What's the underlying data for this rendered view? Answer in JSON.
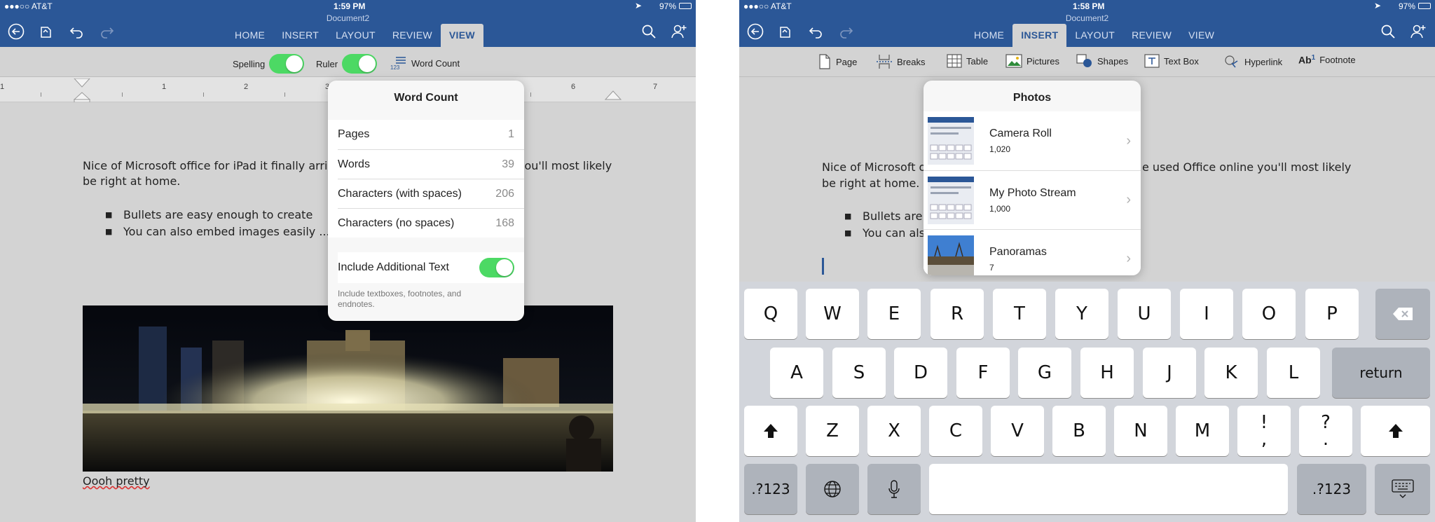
{
  "left": {
    "status": {
      "carrier": "●●●○○ AT&T",
      "time": "1:59 PM",
      "battery": "97%"
    },
    "doc_title": "Document2",
    "tabs": [
      {
        "label": "HOME"
      },
      {
        "label": "INSERT"
      },
      {
        "label": "LAYOUT"
      },
      {
        "label": "REVIEW"
      },
      {
        "label": "VIEW"
      }
    ],
    "active_tab": "VIEW",
    "ribbon": {
      "spelling": "Spelling",
      "ruler": "Ruler",
      "word_count": "Word Count"
    },
    "ruler_numbers": [
      "1",
      "1",
      "2",
      "3",
      "6",
      "7"
    ],
    "body": {
      "para_line1a": "Nice of Microsoft office for iPad it finally arri",
      "para_line1b": "you'll most likely",
      "para_line2": "be right at home.",
      "bullets": [
        "Bullets are easy enough to create",
        "You can also embed images easily ...."
      ],
      "caption": "Oooh pretty"
    },
    "word_count_popover": {
      "title": "Word Count",
      "rows": [
        {
          "label": "Pages",
          "value": "1"
        },
        {
          "label": "Words",
          "value": "39"
        },
        {
          "label": "Characters (with spaces)",
          "value": "206"
        },
        {
          "label": "Characters (no spaces)",
          "value": "168"
        }
      ],
      "include_label": "Include Additional Text",
      "include_note_line1": "Include textboxes, footnotes, and",
      "include_note_line2": "endnotes.",
      "include_on": true
    }
  },
  "right": {
    "status": {
      "carrier": "●●●○○ AT&T",
      "time": "1:58 PM",
      "battery": "97%"
    },
    "doc_title": "Document2",
    "tabs": [
      {
        "label": "HOME"
      },
      {
        "label": "INSERT"
      },
      {
        "label": "LAYOUT"
      },
      {
        "label": "REVIEW"
      },
      {
        "label": "VIEW"
      }
    ],
    "active_tab": "INSERT",
    "ribbon": {
      "page": "Page",
      "breaks": "Breaks",
      "table": "Table",
      "pictures": "Pictures",
      "shapes": "Shapes",
      "text_box": "Text Box",
      "hyperlink": "Hyperlink",
      "footnote": "Footnote",
      "footnote_glyph": "Ab",
      "footnote_sup": "1"
    },
    "body": {
      "para_line1a": "Nice of Microsoft o",
      "para_line1b": "e used Office online you'll most likely",
      "para_line2": "be right at home.",
      "bullets": [
        "Bullets are",
        "You can als"
      ]
    },
    "photos_popover": {
      "title": "Photos",
      "albums": [
        {
          "name": "Camera Roll",
          "count": "1,020"
        },
        {
          "name": "My Photo Stream",
          "count": "1,000"
        },
        {
          "name": "Panoramas",
          "count": "7"
        }
      ]
    },
    "keyboard": {
      "row1": [
        "Q",
        "W",
        "E",
        "R",
        "T",
        "Y",
        "U",
        "I",
        "O",
        "P"
      ],
      "row2": [
        "A",
        "S",
        "D",
        "F",
        "G",
        "H",
        "J",
        "K",
        "L"
      ],
      "row3": [
        "Z",
        "X",
        "C",
        "V",
        "B",
        "N",
        "M"
      ],
      "punct1_top": "!",
      "punct1_bottom": ",",
      "punct2_top": "?",
      "punct2_bottom": ".",
      "return": "return",
      "numbers": ".?123"
    }
  }
}
